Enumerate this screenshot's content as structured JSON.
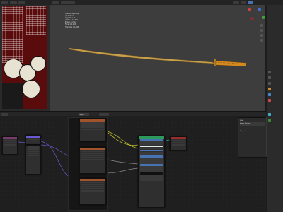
{
  "top_menu": {
    "items": [
      "",
      "",
      "",
      "",
      ""
    ]
  },
  "viewport": {
    "info_lines": [
      "User Perspective",
      "(1) Katana",
      "Objects   1 / 1",
      "Vertices  12,345",
      "Edges     24,512",
      "Faces     12,204",
      "Triangles 24,408"
    ]
  },
  "node_editor": {
    "header_label": "Object",
    "principled_title": "Principled BSDF",
    "output_title": "Material Output",
    "sidepanel": {
      "title": "Node",
      "name_value": "Image Texture",
      "label_value": "",
      "properties_label": "Properties"
    }
  },
  "colors": {
    "blade": "#c9a04a",
    "handle": "#d48a1f",
    "texture_node": "#a0542c",
    "shader_node": "#2c9a5a",
    "output_node": "#9a2c2c",
    "input_node": "#7a3a6a",
    "link_yellow": "#c8c830",
    "link_purple": "#6a5ad0",
    "link_grey": "#888888"
  },
  "icons": [
    "view-icon",
    "nav-gizmo-icon",
    "zoom-icon",
    "camera-icon",
    "grid-icon"
  ]
}
